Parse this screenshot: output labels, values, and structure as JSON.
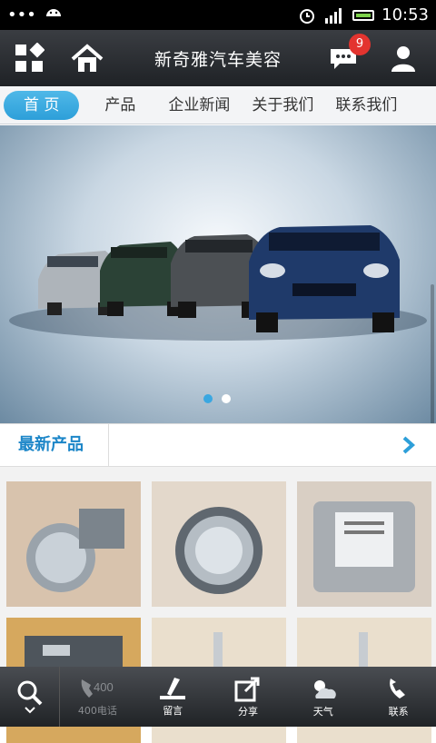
{
  "status_bar": {
    "dots": "•••",
    "time": "10:53"
  },
  "header": {
    "title": "新奇雅汽车美容",
    "message_count": "9"
  },
  "tabs": [
    "首 页",
    "产品",
    "企业新闻",
    "关于我们",
    "联系我们"
  ],
  "banner": {
    "slide_count": 2,
    "active_slide": 1
  },
  "section": {
    "title": "最新产品"
  },
  "bottom_bar": {
    "call_label": "400电话",
    "call_icon_text": "400",
    "message_label": "留言",
    "share_label": "分享",
    "weather_label": "天气",
    "contact_label": "联系"
  },
  "colors": {
    "accent": "#2d9fd9",
    "section_title": "#1c86c8",
    "badge": "#e3342f"
  }
}
